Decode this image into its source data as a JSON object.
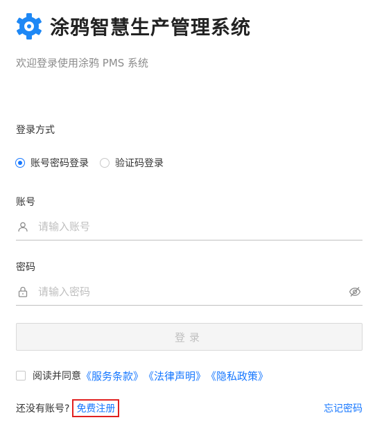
{
  "header": {
    "app_title": "涂鸦智慧生产管理系统",
    "subtitle": "欢迎登录使用涂鸦 PMS 系统"
  },
  "login_method": {
    "label": "登录方式",
    "options": [
      {
        "label": "账号密码登录",
        "checked": true
      },
      {
        "label": "验证码登录",
        "checked": false
      }
    ]
  },
  "account": {
    "label": "账号",
    "placeholder": "请输入账号",
    "icon": "user-icon"
  },
  "password": {
    "label": "密码",
    "placeholder": "请输入密码",
    "icon": "lock-icon",
    "toggle_icon": "eye-slash-icon"
  },
  "login_button": {
    "label": "登录"
  },
  "agreement": {
    "text": "阅读并同意",
    "terms": "《服务条款》",
    "legal": "《法律声明》",
    "privacy": "《隐私政策》"
  },
  "footer": {
    "no_account": "还没有账号?",
    "register": "免费注册",
    "forgot": "忘记密码"
  },
  "colors": {
    "brand": "#1e88f5",
    "accent": "#1677ff",
    "highlight_border": "#e02020"
  }
}
